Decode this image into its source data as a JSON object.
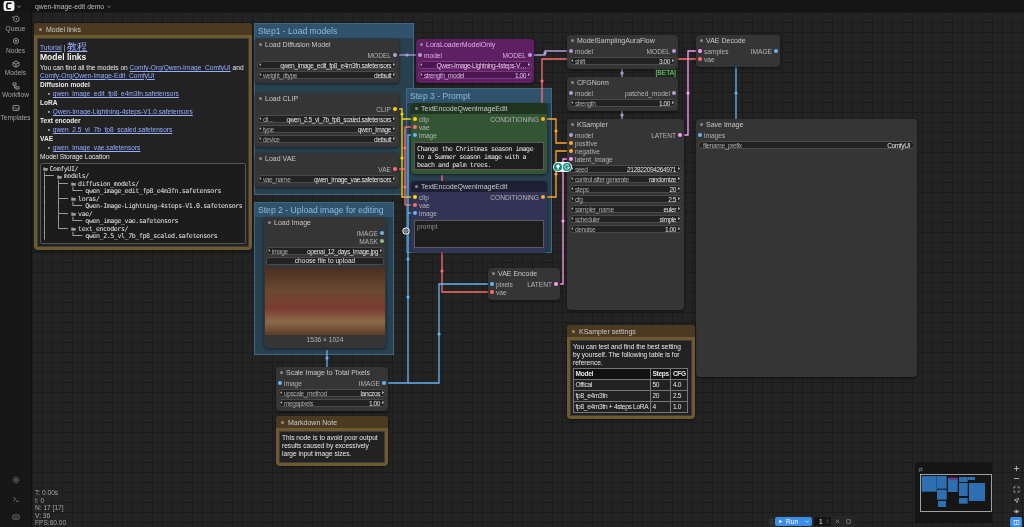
{
  "header": {
    "workflow_tab": "qwen-image-edit demo"
  },
  "sidebar": {
    "items": [
      {
        "label": "Queue"
      },
      {
        "label": "Nodes"
      },
      {
        "label": "Models"
      },
      {
        "label": "Workflow"
      },
      {
        "label": "Templates"
      }
    ]
  },
  "canvas_info": [
    "T: 0.00s",
    "I: 0",
    "N: 17 [17]",
    "V: 36",
    "FPS:60.00"
  ],
  "groups": [
    {
      "title": "Step1 - Load models"
    },
    {
      "title": "Step 2 - Upload image for editing"
    },
    {
      "title": "Step 3 - Prompt"
    }
  ],
  "nodes": [
    {
      "kind": "note",
      "title": "Model links",
      "content": [
        {
          "kind": "link_line",
          "links": [
            "Tutorial",
            "教程"
          ],
          "separator": "|"
        },
        {
          "kind": "heading",
          "text": "Model links"
        },
        {
          "kind": "paragraph",
          "parts": [
            {
              "text": "You can find all the models on "
            },
            {
              "link": "Comfy-Org/Qwen-Image_ComfyUI"
            },
            {
              "text": " and "
            },
            {
              "link": "Comfy-Org/Qwen-Image-Edit_ComfyUI"
            }
          ]
        },
        {
          "kind": "label",
          "text": "Diffusion model"
        },
        {
          "kind": "bullet_link",
          "text": "qwen_image_edit_fp8_e4m3fn.safetensors"
        },
        {
          "kind": "label",
          "text": "LoRA"
        },
        {
          "kind": "bullet_link",
          "text": "Qwen-Image-Lightning-4steps-V1.0.safetensors"
        },
        {
          "kind": "label",
          "text": "Text encoder"
        },
        {
          "kind": "bullet_link",
          "text": "qwen_2.5_vl_7b_fp8_scaled.safetensors"
        },
        {
          "kind": "label",
          "text": "VAE"
        },
        {
          "kind": "bullet_link",
          "text": "qwen_image_vae.safetensors"
        },
        {
          "kind": "paragraph",
          "parts": [
            {
              "text": "Model Storage Location"
            }
          ]
        },
        {
          "kind": "code_tree",
          "lines": [
            {
              "kind": "folder",
              "name": "ComfyUI/"
            },
            {
              "branch": "├── ",
              "kind": "folder",
              "name": "models/"
            },
            {
              "branch": "│   ├── ",
              "kind": "folder",
              "name": "diffusion_models/"
            },
            {
              "branch": "│   │   └── ",
              "kind": "file",
              "name": "qwen_image_edit_fp8_e4m3fn.safetensors"
            },
            {
              "branch": "│   ├── ",
              "kind": "folder",
              "name": "loras/"
            },
            {
              "branch": "│   │   └── ",
              "kind": "file",
              "name": "Qwen-Image-Lightning-4steps-V1.0.safetensors"
            },
            {
              "branch": "│   ├── ",
              "kind": "folder",
              "name": "vae/"
            },
            {
              "branch": "│   │   └── ",
              "kind": "file",
              "name": "qwen_image_vae.safetensors"
            },
            {
              "branch": "│   └── ",
              "kind": "folder",
              "name": "text_encoders/"
            },
            {
              "branch": "│       └── ",
              "kind": "file",
              "name": "qwen_2.5_vl_7b_fp8_scaled.safetensors"
            }
          ]
        }
      ]
    },
    {
      "kind": "node",
      "title": "Load Diffusion Model",
      "bypassed": false,
      "outputs": [
        {
          "name": "MODEL",
          "color": "#b39ddb"
        }
      ],
      "widgets": [
        {
          "kind": "combo",
          "value": "qwen_image_edit_fp8_e4m3fn.safetensors"
        },
        {
          "kind": "combo",
          "label": "weight_dtype",
          "value": "default"
        }
      ]
    },
    {
      "kind": "node",
      "title": "Load CLIP",
      "bypassed": false,
      "outputs": [
        {
          "name": "CLIP",
          "color": "#ffd500"
        }
      ],
      "widgets": [
        {
          "kind": "combo",
          "label": "cli…",
          "value": "qwen_2.5_vl_7b_fp8_scaled.safetensors"
        },
        {
          "kind": "combo",
          "label": "type",
          "value": "qwen_image"
        },
        {
          "kind": "combo",
          "label": "device",
          "value": "default"
        }
      ]
    },
    {
      "kind": "node",
      "title": "Load VAE",
      "bypassed": false,
      "outputs": [
        {
          "name": "VAE",
          "color": "#ff6e6e"
        }
      ],
      "widgets": [
        {
          "kind": "combo",
          "label": "vae_name",
          "value": "qwen_image_vae.safetensors"
        }
      ]
    },
    {
      "kind": "node",
      "title": "LoraLoaderModelOnly",
      "bypassed": true,
      "inputs": [
        {
          "name": "model",
          "color": "#b39ddb"
        }
      ],
      "outputs": [
        {
          "name": "MODEL",
          "color": "#b39ddb"
        }
      ],
      "widgets": [
        {
          "kind": "combo",
          "value": "Qwen-Image-Lightning-4steps-V…"
        },
        {
          "kind": "number",
          "label": "strength_model",
          "value": "1.00"
        }
      ]
    },
    {
      "kind": "node",
      "title": "TextEncodeQwenImageEdit",
      "bypassed": false,
      "color": "#335533",
      "inputs": [
        {
          "name": "clip",
          "color": "#ffd500"
        },
        {
          "name": "vae",
          "color": "#ff6e6e"
        },
        {
          "name": "image",
          "color": "#64b5f6"
        }
      ],
      "outputs": [
        {
          "name": "CONDITIONING",
          "color": "#ffa931"
        }
      ],
      "textarea": {
        "value": "Change the Christmas season image to a Summer season image with a beach and palm trees."
      }
    },
    {
      "kind": "node",
      "title": "TextEncodeQwenImageEdit",
      "bypassed": false,
      "color": "#333355",
      "inputs": [
        {
          "name": "clip",
          "color": "#ffd500"
        },
        {
          "name": "vae",
          "color": "#ff6e6e"
        },
        {
          "name": "image",
          "color": "#64b5f6"
        }
      ],
      "outputs": [
        {
          "name": "CONDITIONING",
          "color": "#ffa931"
        }
      ],
      "textarea": {
        "placeholder": "prompt"
      }
    },
    {
      "kind": "node",
      "title": "ModelSamplingAuraFlow",
      "bypassed": false,
      "inputs": [
        {
          "name": "model",
          "color": "#b39ddb"
        }
      ],
      "outputs": [
        {
          "name": "MODEL",
          "color": "#b39ddb"
        }
      ],
      "widgets": [
        {
          "kind": "number",
          "label": "shift",
          "value": "3.00"
        }
      ],
      "badge": "[BETA]"
    },
    {
      "kind": "node",
      "title": "CFGNorm",
      "bypassed": false,
      "inputs": [
        {
          "name": "model",
          "color": "#b39ddb"
        }
      ],
      "outputs": [
        {
          "name": "patched_model",
          "color": "#b39ddb"
        }
      ],
      "widgets": [
        {
          "kind": "number",
          "label": "strength",
          "value": "1.00"
        }
      ]
    },
    {
      "kind": "node",
      "title": "KSampler",
      "bypassed": false,
      "inputs": [
        {
          "name": "model",
          "color": "#b39ddb"
        },
        {
          "name": "positive",
          "color": "#ffa931"
        },
        {
          "name": "negative",
          "color": "#ffa931"
        },
        {
          "name": "latent_image",
          "color": "#ff9cf9"
        }
      ],
      "outputs": [
        {
          "name": "LATENT",
          "color": "#ff9cf9"
        }
      ],
      "widgets": [
        {
          "kind": "number",
          "label": "seed",
          "value": "212822094264971"
        },
        {
          "kind": "combo",
          "label": "control after generate",
          "value": "randomize"
        },
        {
          "kind": "number",
          "label": "steps",
          "value": "20"
        },
        {
          "kind": "number",
          "label": "cfg",
          "value": "2.5"
        },
        {
          "kind": "combo",
          "label": "sampler_name",
          "value": "euler"
        },
        {
          "kind": "combo",
          "label": "scheduler",
          "value": "simple"
        },
        {
          "kind": "number",
          "label": "denoise",
          "value": "1.00"
        }
      ]
    },
    {
      "kind": "node",
      "title": "VAE Decode",
      "bypassed": false,
      "inputs": [
        {
          "name": "samples",
          "color": "#ff9cf9"
        },
        {
          "name": "vae",
          "color": "#ff6e6e"
        }
      ],
      "outputs": [
        {
          "name": "IMAGE",
          "color": "#64b5f6"
        }
      ]
    },
    {
      "kind": "node",
      "title": "Save Image",
      "bypassed": false,
      "inputs": [
        {
          "name": "images",
          "color": "#64b5f6"
        }
      ],
      "widgets": [
        {
          "kind": "text",
          "label": "filename_prefix",
          "value": "ComfyUI"
        }
      ]
    },
    {
      "kind": "node",
      "title": "Load Image",
      "bypassed": false,
      "outputs": [
        {
          "name": "IMAGE",
          "color": "#64b5f6"
        },
        {
          "name": "MASK",
          "color": "#81c784"
        }
      ],
      "widgets": [
        {
          "kind": "combo",
          "label": "image",
          "value": "openai_12_days_image.jpg"
        },
        {
          "kind": "button",
          "label": "choose file to upload"
        }
      ],
      "image_preview": {
        "caption": "1536 × 1024"
      }
    },
    {
      "kind": "node",
      "title": "Scale Image to Total Pixels",
      "bypassed": false,
      "inputs": [
        {
          "name": "image",
          "color": "#64b5f6"
        }
      ],
      "outputs": [
        {
          "name": "IMAGE",
          "color": "#64b5f6"
        }
      ],
      "widgets": [
        {
          "kind": "combo",
          "label": "upscale_method",
          "value": "lanczos"
        },
        {
          "kind": "number",
          "label": "megapixels",
          "value": "1.00"
        }
      ]
    },
    {
      "kind": "node",
      "title": "VAE Encode",
      "bypassed": false,
      "inputs": [
        {
          "name": "pixels",
          "color": "#64b5f6"
        },
        {
          "name": "vae",
          "color": "#ff6e6e"
        }
      ],
      "outputs": [
        {
          "name": "LATENT",
          "color": "#ff9cf9"
        }
      ]
    },
    {
      "kind": "note",
      "title": "Markdown Note",
      "content": [
        {
          "kind": "paragraph",
          "parts": [
            {
              "text": "This node is to avoid poor output results caused by excessively large input image sizes."
            }
          ]
        }
      ]
    },
    {
      "kind": "note",
      "title": "KSampler settings",
      "content": [
        {
          "kind": "paragraph",
          "parts": [
            {
              "text": "You can test and find the best setting by yourself. The following table is for reference."
            }
          ]
        },
        {
          "kind": "table",
          "columns": [
            "Model",
            "Steps",
            "CFG"
          ],
          "rows": [
            [
              "Offical",
              "50",
              "4.0"
            ],
            [
              "fp8_e4m3fn",
              "20",
              "2.5"
            ],
            [
              "fp8_e4m3fn + 4steps LoRA",
              "4",
              "1.0"
            ]
          ]
        }
      ]
    }
  ],
  "canvas_tools": [
    {
      "selected": false
    },
    {
      "selected": false
    },
    {
      "selected": false
    },
    {
      "selected": false
    },
    {
      "selected": false
    },
    {
      "selected": true
    }
  ],
  "run_bar": {
    "run_label": "Run",
    "batch_count": "1"
  }
}
